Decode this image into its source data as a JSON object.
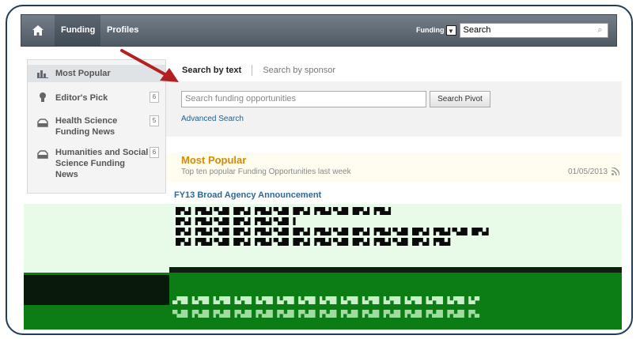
{
  "nav": {
    "tabs": [
      "Funding",
      "Profiles"
    ],
    "search_scope": "Funding",
    "search_value": "Search"
  },
  "sidebar": {
    "items": [
      {
        "label": "Most Popular",
        "count": ""
      },
      {
        "label": "Editor's Pick",
        "count": "6"
      },
      {
        "label": "Health Science Funding News",
        "count": "5"
      },
      {
        "label": "Humanities and Social Science Funding News",
        "count": "6"
      }
    ]
  },
  "main": {
    "tab_text": "Search by text",
    "tab_sponsor": "Search by sponsor",
    "search_placeholder": "Search funding opportunities",
    "pivot_button": "Search Pivot",
    "advanced_link": "Advanced Search",
    "popular_title": "Most Popular",
    "popular_subtitle": "Top ten popular Funding Opportunities last week",
    "popular_date": "01/05/2013",
    "first_item_title": "FY13 Broad Agency Announcement"
  },
  "colors": {
    "topbar": "#5a646e",
    "accent_orange": "#d88a00",
    "link_blue": "#1f5e8c",
    "annotation_arrow": "#b3201f"
  }
}
